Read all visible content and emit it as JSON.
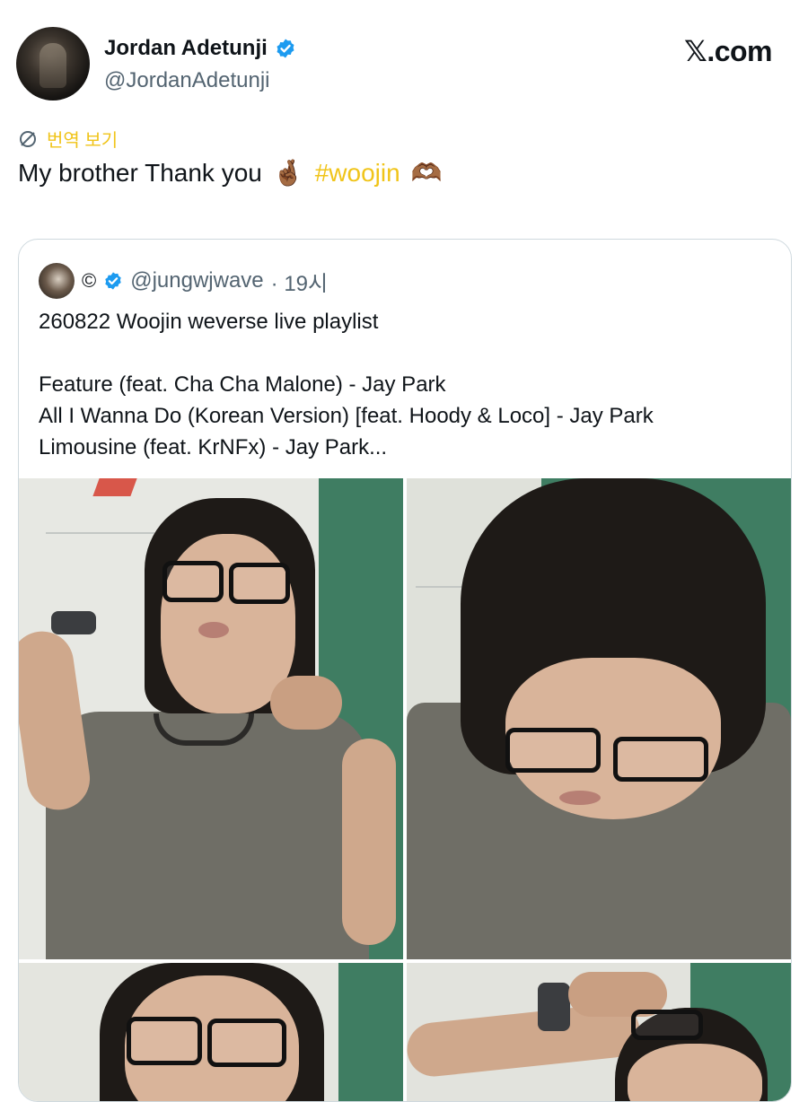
{
  "header": {
    "name": "Jordan Adetunji",
    "handle": "@JordanAdetunji",
    "brand": "𝕏.com"
  },
  "translate": {
    "label": "번역 보기",
    "icon": "translate-icon"
  },
  "tweet": {
    "text": "My brother Thank you",
    "emoji_1": "🤞🏾",
    "hashtag": "#woojin",
    "emoji_2": "🫶🏾"
  },
  "quote": {
    "copyright_symbol": "©",
    "handle": "@jungwjwave",
    "time": "· 19시",
    "line_1": "260822 Woojin weverse live playlist",
    "line_2": "Feature (feat. Cha Cha Malone) - Jay Park",
    "line_3": "All I Wanna Do (Korean Version) [feat. Hoody & Loco] - Jay Park",
    "line_4": "Limousine (feat. KrNFx) - Jay Park..."
  },
  "colors": {
    "accent": "#f0c419",
    "verified": "#1d9bf0",
    "text": "#0f1419",
    "muted": "#536471",
    "border": "#cfd9de"
  }
}
